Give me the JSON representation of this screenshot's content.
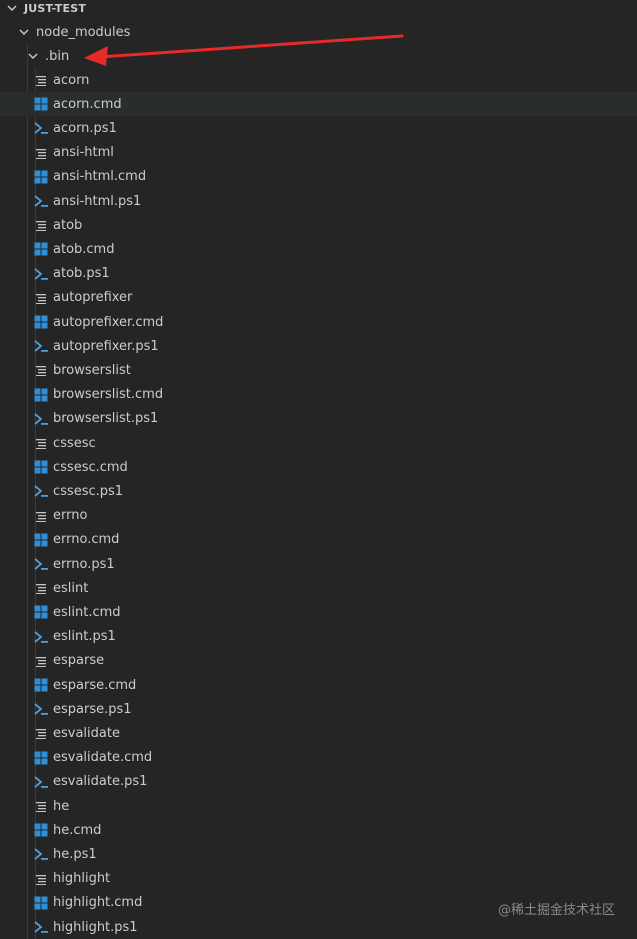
{
  "explorer": {
    "section_title": "JUST-TEST",
    "node_modules": "node_modules",
    "bin_folder": ".bin",
    "files": [
      {
        "name": "acorn",
        "type": "file"
      },
      {
        "name": "acorn.cmd",
        "type": "cmd"
      },
      {
        "name": "acorn.ps1",
        "type": "ps1"
      },
      {
        "name": "ansi-html",
        "type": "file"
      },
      {
        "name": "ansi-html.cmd",
        "type": "cmd"
      },
      {
        "name": "ansi-html.ps1",
        "type": "ps1"
      },
      {
        "name": "atob",
        "type": "file"
      },
      {
        "name": "atob.cmd",
        "type": "cmd"
      },
      {
        "name": "atob.ps1",
        "type": "ps1"
      },
      {
        "name": "autoprefixer",
        "type": "file"
      },
      {
        "name": "autoprefixer.cmd",
        "type": "cmd"
      },
      {
        "name": "autoprefixer.ps1",
        "type": "ps1"
      },
      {
        "name": "browserslist",
        "type": "file"
      },
      {
        "name": "browserslist.cmd",
        "type": "cmd"
      },
      {
        "name": "browserslist.ps1",
        "type": "ps1"
      },
      {
        "name": "cssesc",
        "type": "file"
      },
      {
        "name": "cssesc.cmd",
        "type": "cmd"
      },
      {
        "name": "cssesc.ps1",
        "type": "ps1"
      },
      {
        "name": "errno",
        "type": "file"
      },
      {
        "name": "errno.cmd",
        "type": "cmd"
      },
      {
        "name": "errno.ps1",
        "type": "ps1"
      },
      {
        "name": "eslint",
        "type": "file"
      },
      {
        "name": "eslint.cmd",
        "type": "cmd"
      },
      {
        "name": "eslint.ps1",
        "type": "ps1"
      },
      {
        "name": "esparse",
        "type": "file"
      },
      {
        "name": "esparse.cmd",
        "type": "cmd"
      },
      {
        "name": "esparse.ps1",
        "type": "ps1"
      },
      {
        "name": "esvalidate",
        "type": "file"
      },
      {
        "name": "esvalidate.cmd",
        "type": "cmd"
      },
      {
        "name": "esvalidate.ps1",
        "type": "ps1"
      },
      {
        "name": "he",
        "type": "file"
      },
      {
        "name": "he.cmd",
        "type": "cmd"
      },
      {
        "name": "he.ps1",
        "type": "ps1"
      },
      {
        "name": "highlight",
        "type": "file"
      },
      {
        "name": "highlight.cmd",
        "type": "cmd"
      },
      {
        "name": "highlight.ps1",
        "type": "ps1"
      }
    ],
    "selected_file": "acorn.cmd"
  },
  "watermark": "@稀土掘金技术社区",
  "colors": {
    "background": "#252526",
    "text": "#cccccc",
    "selected_row": "#2a2d2e",
    "windows_icon": "#2e8fd6",
    "powershell_icon": "#4a9fdc",
    "arrow": "#e52a2a"
  },
  "icons": {
    "file": "text-lines-icon",
    "cmd": "windows-logo-icon",
    "ps1": "powershell-prompt-icon",
    "folder_open": "chevron-down-icon"
  }
}
